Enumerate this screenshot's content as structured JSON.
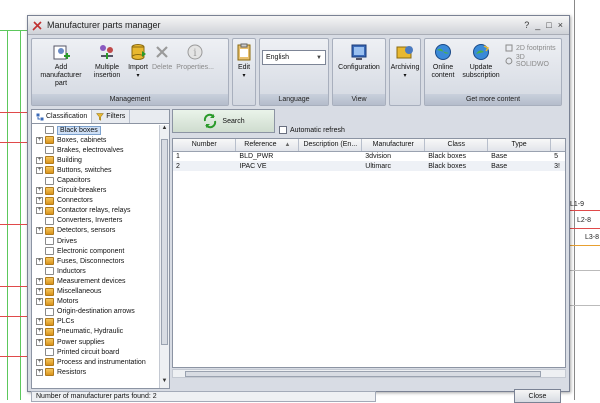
{
  "window": {
    "title": "Manufacturer parts manager",
    "controls": [
      "?",
      "_",
      "□",
      "×"
    ]
  },
  "background": {
    "wire_labels": [
      "L1-9",
      "L2-8",
      "L3-8"
    ]
  },
  "ribbon": {
    "management": {
      "caption": "Management",
      "add_label": "Add manufacturer part",
      "multiple_label": "Multiple insertion",
      "import_label": "Import",
      "delete_label": "Delete",
      "properties_label": "Properties..."
    },
    "edit": {
      "label": "Edit"
    },
    "language": {
      "caption": "Language",
      "value": "English"
    },
    "view": {
      "caption": "View",
      "configuration_label": "Configuration"
    },
    "archiving": {
      "label": "Archiving"
    },
    "get_more": {
      "caption": "Get more content",
      "online_label": "Online content",
      "update_label": "Update subscription",
      "footprints_label": "2D footprints",
      "solidworks_label": "3D SOLIDWO"
    }
  },
  "left": {
    "tab_classification": "Classification",
    "tab_filters": "Filters",
    "tree": [
      {
        "label": "Black boxes",
        "expandable": false,
        "selected": true,
        "plain": true
      },
      {
        "label": "Boxes, cabinets",
        "expandable": true
      },
      {
        "label": "Brakes, electrovalves",
        "expandable": false,
        "plain": true
      },
      {
        "label": "Building",
        "expandable": true
      },
      {
        "label": "Buttons, switches",
        "expandable": true
      },
      {
        "label": "Capacitors",
        "expandable": false,
        "plain": true
      },
      {
        "label": "Circuit-breakers",
        "expandable": true
      },
      {
        "label": "Connectors",
        "expandable": true
      },
      {
        "label": "Contactor relays, relays",
        "expandable": true
      },
      {
        "label": "Converters, Inverters",
        "expandable": false,
        "plain": true
      },
      {
        "label": "Detectors, sensors",
        "expandable": true
      },
      {
        "label": "Drives",
        "expandable": false,
        "plain": true
      },
      {
        "label": "Electronic component",
        "expandable": false,
        "plain": true
      },
      {
        "label": "Fuses, Disconnectors",
        "expandable": true
      },
      {
        "label": "Inductors",
        "expandable": false,
        "plain": true
      },
      {
        "label": "Measurement devices",
        "expandable": true
      },
      {
        "label": "Miscellaneous",
        "expandable": true
      },
      {
        "label": "Motors",
        "expandable": true
      },
      {
        "label": "Origin-destination arrows",
        "expandable": false,
        "plain": true
      },
      {
        "label": "PLCs",
        "expandable": true
      },
      {
        "label": "Pneumatic, Hydraulic",
        "expandable": true
      },
      {
        "label": "Power supplies",
        "expandable": true
      },
      {
        "label": "Printed circuit board",
        "expandable": false,
        "plain": true
      },
      {
        "label": "Process and instrumentation",
        "expandable": true
      },
      {
        "label": "Resistors",
        "expandable": true
      }
    ]
  },
  "search": {
    "label": "Search",
    "auto_refresh_label": "Automatic refresh"
  },
  "table": {
    "columns": [
      "Number",
      "Reference",
      "Description (En...",
      "Manufacturer",
      "Class",
      "Type",
      ""
    ],
    "sort_indicator": "▲",
    "rows": [
      [
        "1",
        "BLD_PWR",
        "",
        "3dvision",
        "Black boxes",
        "Base",
        "5"
      ],
      [
        "2",
        "IPAC VE",
        "",
        "Ultimarc",
        "Black boxes",
        "Base",
        "3!"
      ]
    ]
  },
  "status": {
    "text": "Number of manufacturer parts found: 2"
  },
  "close_label": "Close"
}
